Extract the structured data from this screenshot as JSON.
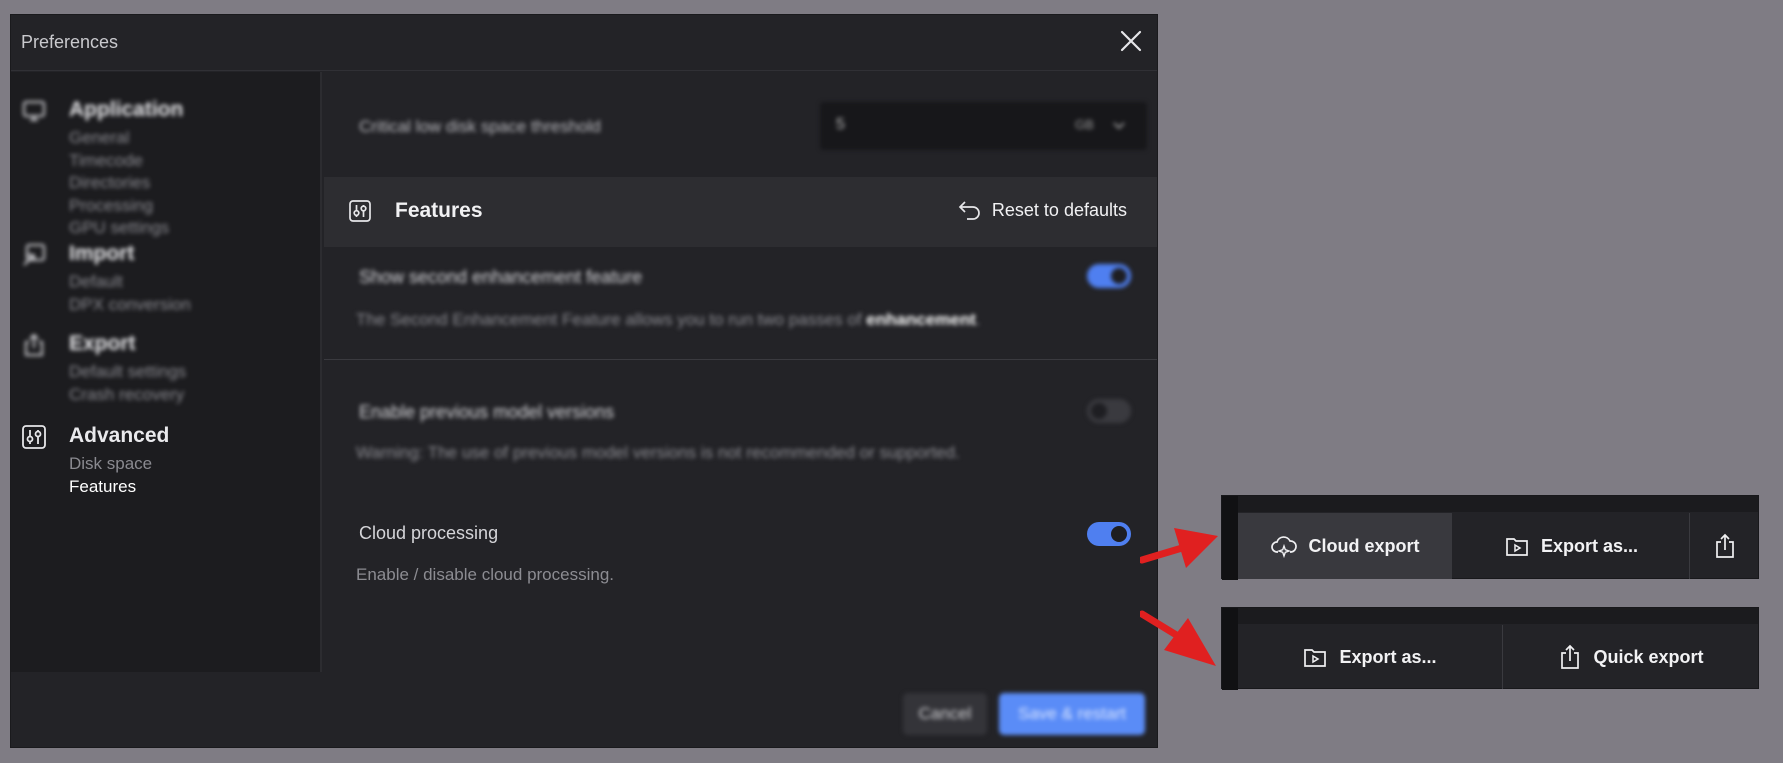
{
  "dialog": {
    "title": "Preferences",
    "sidebar": [
      {
        "heading": "Application",
        "icon": "monitor-icon",
        "items": [
          "General",
          "Timecode",
          "Directories",
          "Processing",
          "GPU settings"
        ]
      },
      {
        "heading": "Import",
        "icon": "import-icon",
        "items": [
          "Default",
          "DPX conversion"
        ]
      },
      {
        "heading": "Export",
        "icon": "export-icon",
        "items": [
          "Default settings",
          "Crash recovery"
        ]
      },
      {
        "heading": "Advanced",
        "icon": "sliders-icon",
        "items": [
          "Disk space",
          "Features"
        ],
        "active_item": "Features"
      }
    ],
    "disk_threshold": {
      "label": "Critical low disk space threshold",
      "value": "5",
      "unit": "GB"
    },
    "features": {
      "title": "Features",
      "reset_label": "Reset to defaults",
      "settings": [
        {
          "label": "Show second enhancement feature",
          "desc_prefix": "The Second Enhancement Feature allows you to run two passes of ",
          "desc_bold": "enhancement",
          "desc_suffix": ".",
          "enabled": true
        },
        {
          "label": "Enable previous model versions",
          "desc": "Warning: The use of previous model versions is not recommended or supported.",
          "enabled": false
        },
        {
          "label": "Cloud processing",
          "desc": "Enable / disable cloud processing.",
          "enabled": true
        }
      ]
    },
    "buttons": {
      "cancel": "Cancel",
      "save": "Save & restart"
    }
  },
  "toolbar_top": {
    "cloud_export": "Cloud export",
    "export_as": "Export as..."
  },
  "toolbar_bottom": {
    "export_as": "Export as...",
    "quick_export": "Quick export"
  },
  "colors": {
    "accent": "#5a8cf7",
    "arrow": "#e02020",
    "background": "#7f7c84"
  }
}
